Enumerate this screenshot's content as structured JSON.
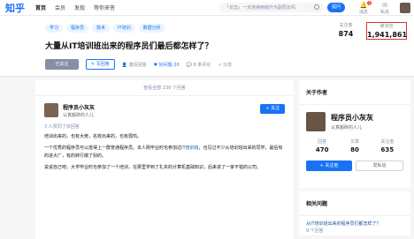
{
  "topbar": {
    "logo": "知乎",
    "nav": [
      "首页",
      "会员",
      "发现",
      "等你来答"
    ],
    "search_placeholder": "「长剪」一天连续两级升为副局长吗",
    "ask_label": "提问",
    "message_label": "消息",
    "private_msg_label": "私信",
    "message_badge": "1"
  },
  "question": {
    "tags": [
      "学习",
      "程序员",
      "技术",
      "IT培训",
      "数据分析"
    ],
    "title": "大量从IT培训班出来的程序员们最后都怎样了？",
    "followers_label": "关注者",
    "followers_value": "874",
    "views_label": "被浏览",
    "views_value": "1,941,861",
    "followed_label": "已关注",
    "write_answer_label": "写回答",
    "invite_label": "邀请回答",
    "good_question_label": "好问题 20",
    "comments_label": "8 条评论",
    "share_label": "分享"
  },
  "main": {
    "view_all": "查看全部 239 个回答",
    "answer": {
      "author_name": "程序员小灰灰",
      "author_bio": "认真搬砖的人儿",
      "follow_label": "+ 关注",
      "approve_text": "3 人赞同了该回答",
      "p1": "培训出来的，也有大佬，名校出来的，也有弱鸡。",
      "p2_a": "一个优秀的程序员可以抵得上一群普通程序员。本人刚毕业时也参加过",
      "p2_link": "IT培训班",
      "p2_b": "，也见过不少从培训班出来的同学，最后有的进大厂，有的转行做了别的。",
      "p3": "说说自己吧，大学毕业时也参加了一个培训，在那里学到了扎实的计算机基础知识，后来进了一家不错的公司。"
    }
  },
  "sidebar": {
    "about_author_title": "关于作者",
    "name": "程序员小灰灰",
    "bio": "认真搬砖的人儿",
    "answers_label": "回答",
    "answers_value": "470",
    "articles_label": "文章",
    "articles_value": "80",
    "followers_label": "关注者",
    "followers_value": "635",
    "follow_label": "+ 关注他",
    "message_label": "发私信",
    "related_title": "相关问题",
    "related_q": "从IT培训班出来的程序员们都怎样了？",
    "related_meta": "9 个回答"
  }
}
